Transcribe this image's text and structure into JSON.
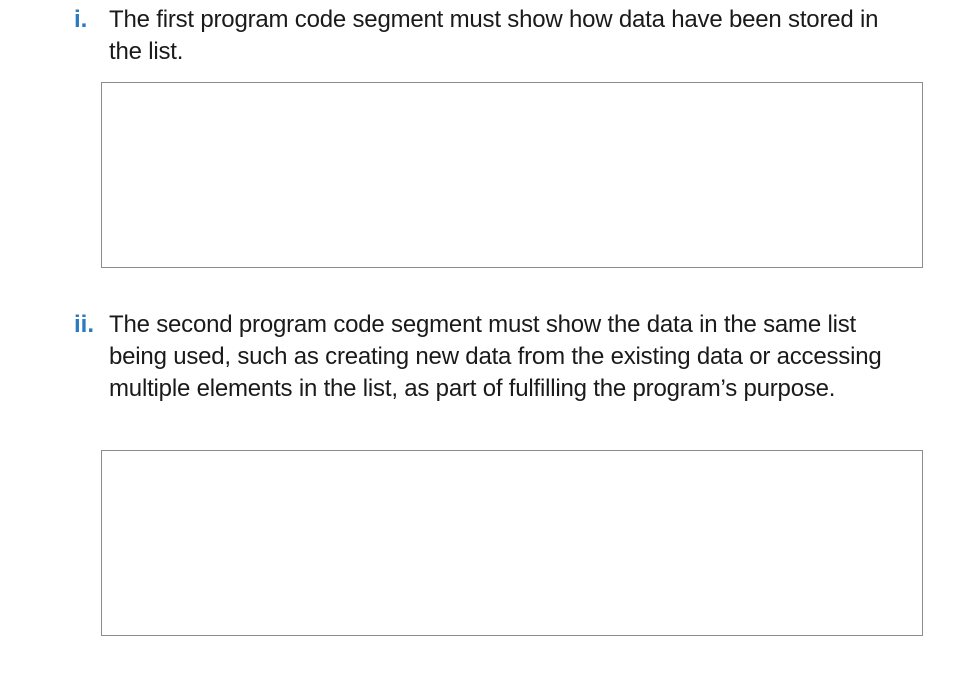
{
  "items": [
    {
      "numeral": "i.",
      "text": "The first program code segment must show how data have been stored in the list."
    },
    {
      "numeral": "ii.",
      "text": "The second program code segment must show the data in the same list being used, such as creating new data from the existing data or accessing multiple elements in the list, as part of fulfilling the program’s purpose."
    }
  ],
  "colors": {
    "numeral": "#2b7bbf",
    "text": "#1a1a1a",
    "box_border": "#8c8c8c"
  }
}
